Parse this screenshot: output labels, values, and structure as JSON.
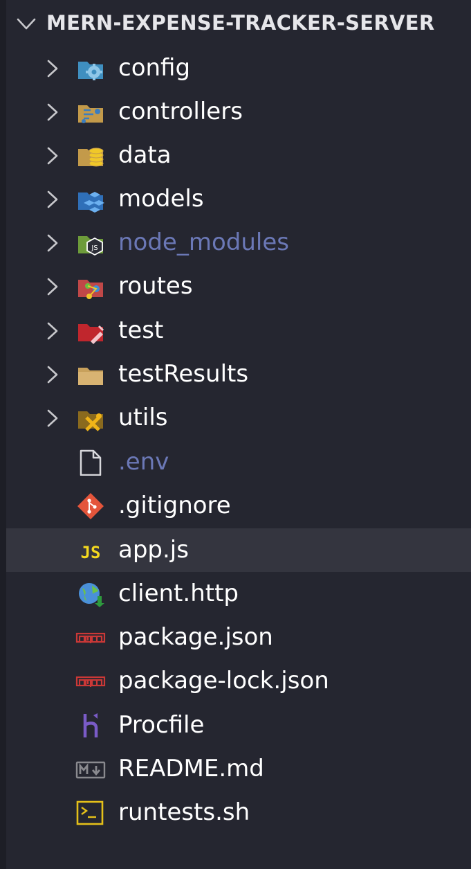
{
  "explorer": {
    "title": "MERN-EXPENSE-TRACKER-SERVER",
    "selected_item": "app.js",
    "items": [
      {
        "label": "config",
        "type": "folder",
        "icon": "config-folder-icon",
        "dimmed": false
      },
      {
        "label": "controllers",
        "type": "folder",
        "icon": "controllers-folder-icon",
        "dimmed": false
      },
      {
        "label": "data",
        "type": "folder",
        "icon": "data-folder-icon",
        "dimmed": false
      },
      {
        "label": "models",
        "type": "folder",
        "icon": "models-folder-icon",
        "dimmed": false
      },
      {
        "label": "node_modules",
        "type": "folder",
        "icon": "node-folder-icon",
        "dimmed": true
      },
      {
        "label": "routes",
        "type": "folder",
        "icon": "routes-folder-icon",
        "dimmed": false
      },
      {
        "label": "test",
        "type": "folder",
        "icon": "test-folder-icon",
        "dimmed": false
      },
      {
        "label": "testResults",
        "type": "folder",
        "icon": "folder-icon",
        "dimmed": false
      },
      {
        "label": "utils",
        "type": "folder",
        "icon": "utils-folder-icon",
        "dimmed": false
      },
      {
        "label": ".env",
        "type": "file",
        "icon": "file-icon",
        "dimmed": true
      },
      {
        "label": ".gitignore",
        "type": "file",
        "icon": "git-icon",
        "dimmed": false
      },
      {
        "label": "app.js",
        "type": "file",
        "icon": "javascript-icon",
        "dimmed": false
      },
      {
        "label": "client.http",
        "type": "file",
        "icon": "http-icon",
        "dimmed": false
      },
      {
        "label": "package.json",
        "type": "file",
        "icon": "npm-icon",
        "dimmed": false
      },
      {
        "label": "package-lock.json",
        "type": "file",
        "icon": "npm-icon",
        "dimmed": false
      },
      {
        "label": "Procfile",
        "type": "file",
        "icon": "heroku-icon",
        "dimmed": false
      },
      {
        "label": "README.md",
        "type": "file",
        "icon": "markdown-icon",
        "dimmed": false
      },
      {
        "label": "runtests.sh",
        "type": "file",
        "icon": "terminal-icon",
        "dimmed": false
      }
    ]
  },
  "colors": {
    "background": "#252630",
    "selected_row": "#34353f",
    "text": "#ffffff",
    "dimmed_text": "#6b78b6"
  }
}
